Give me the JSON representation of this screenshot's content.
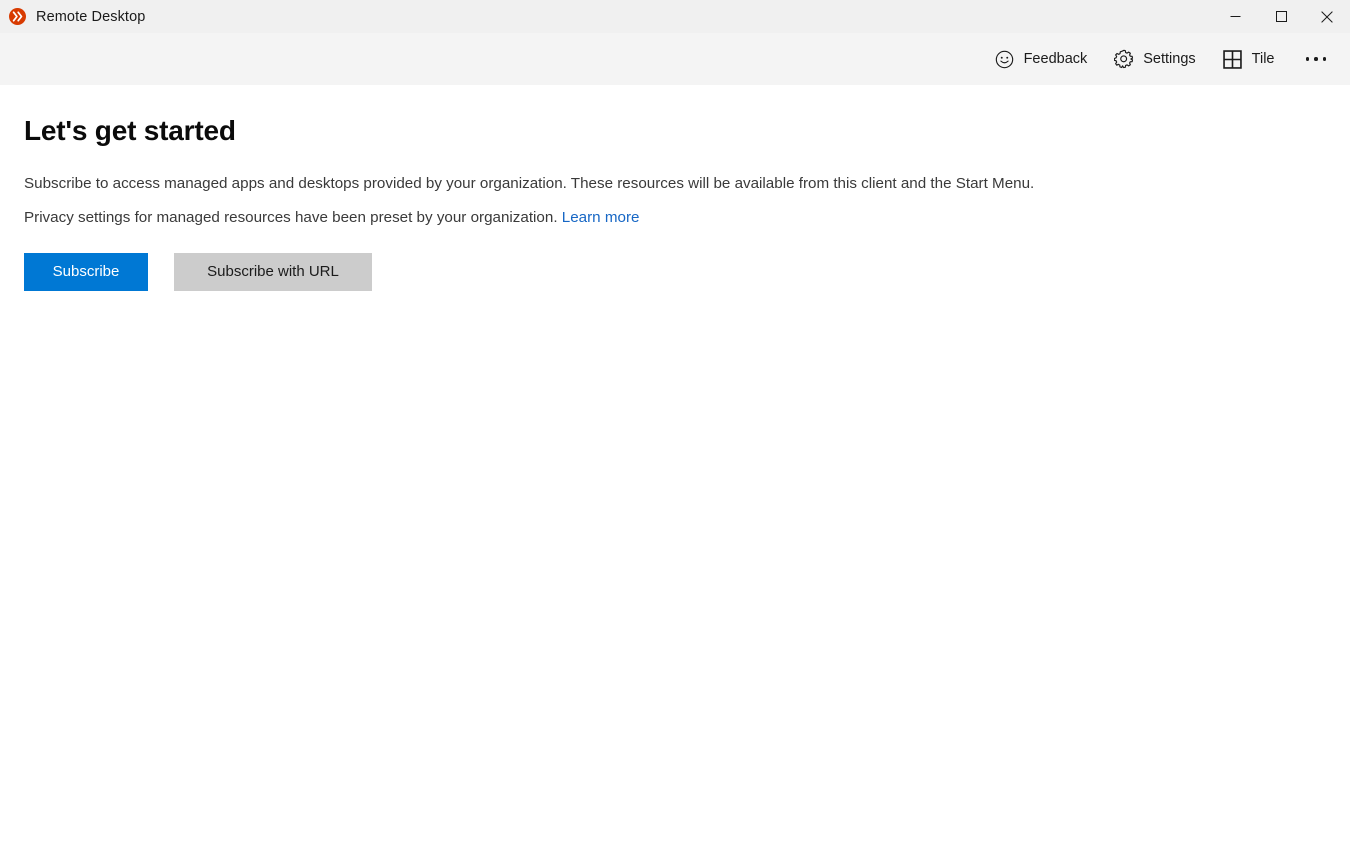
{
  "window": {
    "app_icon": "remote-desktop-logo-icon",
    "title": "Remote Desktop",
    "controls": {
      "minimize": "minimize-icon",
      "maximize": "maximize-icon",
      "close": "close-icon"
    }
  },
  "commandbar": {
    "items": [
      {
        "id": "feedback",
        "label": "Feedback",
        "icon": "smiley-face-icon"
      },
      {
        "id": "settings",
        "label": "Settings",
        "icon": "gear-icon"
      },
      {
        "id": "tile",
        "label": "Tile",
        "icon": "grid-tile-icon"
      }
    ],
    "more": {
      "label": "",
      "icon": "ellipsis-icon"
    }
  },
  "main": {
    "title": "Let's get started",
    "paragraph1": "Subscribe to access managed apps and desktops provided by your organization. These resources will be available from this client and the Start Menu.",
    "paragraph2_text": "Privacy settings for managed resources have been preset by your organization.",
    "paragraph2_link": "Learn more",
    "buttons": {
      "primary": "Subscribe",
      "secondary": "Subscribe with URL"
    }
  },
  "colors": {
    "accent_blue": "#0078d4",
    "link_blue": "#1767c5",
    "secondary_button": "#cccccc",
    "titlebar": "#f0f0f0",
    "commandbar": "#f4f4f4",
    "app_icon": "#d83b01"
  }
}
